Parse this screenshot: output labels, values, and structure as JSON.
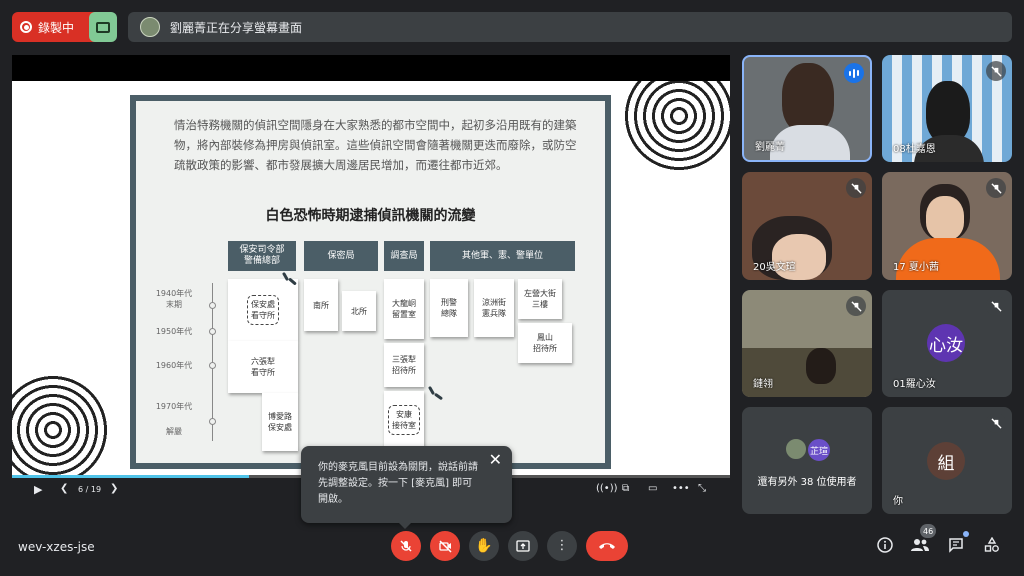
{
  "topbar": {
    "recording_label": "錄製中",
    "share_banner": "劉麗菁正在分享螢幕畫面"
  },
  "slide": {
    "paragraph": "情治特務機關的偵訊空間隱身在大家熟悉的都市空間中，起初多沿用既有的建築物，將內部裝修為押房與偵訊室。這些偵訊空間會隨著機關更迭而廢除，或防空疏散政策的影響、都市發展擴大周邊居民增加，而遷往都市近郊。",
    "title": "白色恐怖時期逮捕偵訊機關的流變",
    "headers": [
      "保安司令部\n警備總部",
      "保密局",
      "調查局",
      "其他軍、憲、警單位"
    ],
    "years": [
      "1940年代\n末期",
      "1950年代",
      "1960年代",
      "1970年代",
      "解嚴"
    ],
    "cards": {
      "c1": "保安處\n看守所",
      "c2": "六張犁\n看守所",
      "c3": "博愛路\n保安處",
      "c4": "南所",
      "c5": "北所",
      "c6": "大龍峒\n留置室",
      "c7": "三張犁\n招待所",
      "c8": "安康\n接待室",
      "c9": "刑警\n總隊",
      "c10": "涼洲街\n憲兵隊",
      "c11": "左營大街\n三樓",
      "c12": "鳳山\n招待所"
    }
  },
  "slide_controls": {
    "page": "6 / 19",
    "progress": 0.33
  },
  "participants": [
    {
      "name": "劉麗菁",
      "speaking": true
    },
    {
      "name": "08杜嘉恩",
      "muted": true
    },
    {
      "name": "20吳文瑄",
      "muted": true
    },
    {
      "name": "17 夏小茜",
      "muted": true
    },
    {
      "name": "鏈翎",
      "muted": true
    },
    {
      "name": "01羅心汝",
      "muted": true,
      "initials": "心汝",
      "color": "#5e35b1"
    },
    {
      "name": "還有另外 38 位使用者",
      "initials": "芷瑄",
      "color": "#6a4fc8"
    },
    {
      "name": "你",
      "muted": true,
      "initials": "組",
      "color": "#5d4037"
    }
  ],
  "toast": {
    "message": "你的麥克風目前設為關閉，說話前請先調整設定。按一下 [麥克風] 即可開啟。",
    "close_icon": "close-icon"
  },
  "bottombar": {
    "meeting_code": "wev-xzes-jse",
    "people_count": "46"
  },
  "colors": {
    "record_red": "#d93025",
    "panel": "#4b5e67",
    "accent_blue": "#1a73e8"
  }
}
